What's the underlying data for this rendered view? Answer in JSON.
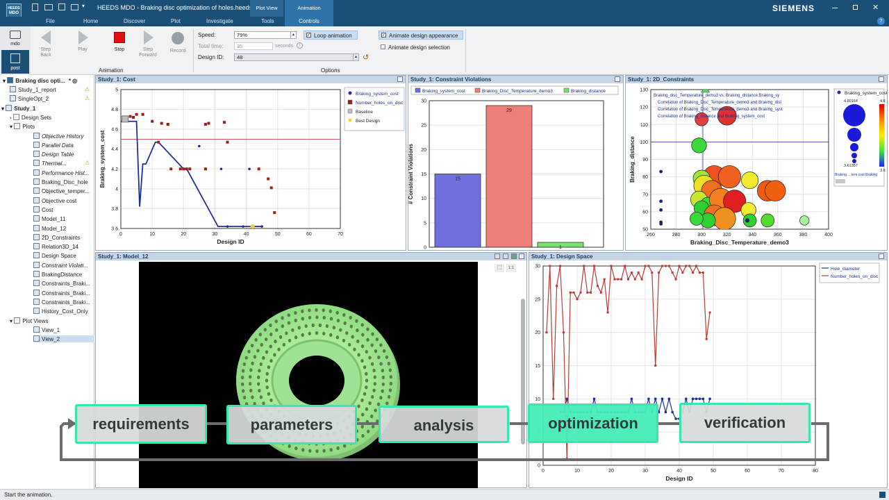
{
  "titlebar": {
    "app": "HEEDS MDO",
    "title": "HEEDS MDO - Braking disc optimization of holes.heeds *",
    "context_group1": "Plot View",
    "context_group2": "Animation",
    "brand": "SIEMENS",
    "app_icon_line1": "HEEDS",
    "app_icon_line2": "MDO"
  },
  "tabs": [
    "File",
    "Home",
    "Discover",
    "Plot",
    "Investigate",
    "Tools",
    "Controls"
  ],
  "ribbon": {
    "step_back": "Step\nBack",
    "step_back_1": "Step",
    "step_back_2": "Back",
    "play": "Play",
    "stop": "Stop",
    "step_fwd_1": "Step",
    "step_fwd_2": "Forward",
    "record": "Record",
    "group_animation": "Animation",
    "group_options": "Options",
    "speed_label": "Speed:",
    "speed_value": "79%",
    "total_time_label": "Total time:",
    "total_time_value": "35",
    "total_time_unit": "seconds",
    "design_id_label": "Design ID:",
    "design_id_value": "48",
    "loop": "Loop animation",
    "animate_appearance": "Animate design appearance",
    "animate_selection": "Animate design selection"
  },
  "leftnav": {
    "mdo": "mdo",
    "post": "post"
  },
  "tree": {
    "root": "Braking disc opti...",
    "items": [
      "Study_1_report",
      "SingleOpt_2",
      "Study_1",
      "Design Sets",
      "Plots",
      "Objective History",
      "Parallel Data",
      "Design Table",
      "Thermal...",
      "Performance Hist...",
      "Braking_Disc_hole",
      "Objective_temper...",
      "Objective cost",
      "Cost",
      "Model_11",
      "Model_12",
      "2D_Constraints",
      "Relation3D_14",
      "Design Space",
      "Constraint Violati...",
      "BrakingDistance",
      "Constraints_Braki...",
      "Constraints_Braki...",
      "Constraints_Braki...",
      "History_Cost_Only",
      "Plot Views",
      "View_1",
      "View_2"
    ]
  },
  "panels": {
    "cost": "Study_1: Cost",
    "cv": "Study_1: Constraint Violations",
    "c2d": "Study_1: 2D_Constraints",
    "model": "Study_1: Model_12",
    "ds": "Study_1: Design Space"
  },
  "chart_data": [
    {
      "type": "scatter",
      "title": "",
      "xlabel": "Design ID",
      "ylabel": "Braking_system_cost",
      "xlim": [
        0,
        70
      ],
      "ylim": [
        3.6,
        5
      ],
      "x_ticks": [
        "0",
        "10",
        "20",
        "30",
        "40",
        "50",
        "60",
        "70"
      ],
      "y_ticks": [
        "3.6",
        "3.8",
        "4",
        "4.2",
        "4.4",
        "4.6",
        "4.8",
        "5"
      ],
      "legend": [
        "Braking_system_cost",
        "Number_holes_on_disc",
        "Baseline",
        "Best Design"
      ],
      "series": [
        {
          "name": "Braking_system_cost",
          "x": [
            25,
            32,
            34,
            39,
            41,
            45
          ],
          "y": [
            4.43,
            4.2,
            3.62,
            3.62,
            4.2,
            3.62
          ]
        },
        {
          "name": "Number_holes_on_disc",
          "x": [
            2,
            3,
            4,
            5,
            7,
            10,
            12,
            13,
            15,
            15,
            16,
            19,
            20,
            21,
            22,
            27,
            27,
            28,
            33,
            34,
            44,
            47,
            48,
            49
          ],
          "y": [
            4.7,
            4.73,
            4.72,
            4.75,
            4.75,
            4.68,
            4.47,
            4.66,
            4.65,
            4.65,
            4.2,
            4.2,
            4.2,
            4.2,
            4.2,
            4.65,
            4.2,
            4.66,
            4.67,
            4.47,
            4.2,
            4.1,
            4.01,
            3.76
          ]
        }
      ],
      "step_line": {
        "x": [
          0,
          5,
          6,
          7,
          8,
          11,
          12,
          20,
          21,
          31,
          32,
          45
        ],
        "y": [
          4.68,
          4.68,
          3.82,
          4.25,
          4.25,
          4.47,
          4.47,
          4.2,
          4.2,
          3.62,
          3.62,
          3.62
        ]
      },
      "baseline_y": 4.5,
      "best_design": {
        "x": 42,
        "y": 3.62
      }
    },
    {
      "type": "bar",
      "title": "",
      "ylabel": "# Constraint Violations",
      "categories": [
        "Braking_system_cost",
        "Braking_Disc_Temperature_demo3",
        "Braking_distance"
      ],
      "values": [
        15,
        29,
        1
      ],
      "ylim": [
        0,
        30
      ],
      "y_ticks": [
        "0",
        "5",
        "10",
        "15",
        "20",
        "25",
        "30"
      ],
      "colors": [
        "#6f6fe0",
        "#ef7d78",
        "#77e36f"
      ]
    },
    {
      "type": "scatter",
      "title": "",
      "xlabel": "Braking_Disc_Temperature_demo3",
      "ylabel": "Braking_distance",
      "xlim": [
        260,
        400
      ],
      "ylim": [
        50,
        130
      ],
      "x_ticks": [
        "260",
        "280",
        "300",
        "320",
        "340",
        "360",
        "380",
        "400"
      ],
      "y_ticks": [
        "50",
        "60",
        "70",
        "80",
        "90",
        "100",
        "110",
        "120",
        "130"
      ],
      "legend_text": [
        "Braking_disc_Temperature_demo3 vs. Braking_distance,Braking_system_cost",
        "Correlation of Braking_Disc_Temperature_demo3 and Braking_distance = -0.",
        "Correlation of Braking_Disc_Temperature_demo3 and Braking_system_cost",
        "Correlation of Braking_distance and Braking_system_cost"
      ],
      "crosshair": {
        "x": 301,
        "y": 100
      },
      "size_legend": {
        "title": "Braking_system_cost",
        "max": "4.80164",
        "min": "3.61357",
        "colorbar_max": "4.8",
        "colorbar_min": "3.6",
        "footer": "Braking ... tem cost  Braking"
      },
      "bubbles": [
        {
          "x": 298,
          "y": 98,
          "s": 8,
          "c": "#3ad83a"
        },
        {
          "x": 300,
          "y": 113,
          "s": 7,
          "c": "#e14040"
        },
        {
          "x": 320,
          "y": 115,
          "s": 10,
          "c": "#e03030"
        },
        {
          "x": 310,
          "y": 80,
          "s": 12,
          "c": "#f05020"
        },
        {
          "x": 322,
          "y": 80,
          "s": 12,
          "c": "#f06020"
        },
        {
          "x": 300,
          "y": 79,
          "s": 9,
          "c": "#9ae83a"
        },
        {
          "x": 302,
          "y": 75,
          "s": 11,
          "c": "#ece020"
        },
        {
          "x": 308,
          "y": 72,
          "s": 11,
          "c": "#f07020"
        },
        {
          "x": 338,
          "y": 78,
          "s": 9,
          "c": "#f2ec30"
        },
        {
          "x": 352,
          "y": 72,
          "s": 11,
          "c": "#f05a10"
        },
        {
          "x": 358,
          "y": 72,
          "s": 11,
          "c": "#f06010"
        },
        {
          "x": 298,
          "y": 67,
          "s": 9,
          "c": "#c8e830"
        },
        {
          "x": 305,
          "y": 64,
          "s": 8,
          "c": "#3ad83a"
        },
        {
          "x": 315,
          "y": 67,
          "s": 12,
          "c": "#f08020"
        },
        {
          "x": 326,
          "y": 66,
          "s": 12,
          "c": "#e02020"
        },
        {
          "x": 337,
          "y": 61,
          "s": 8,
          "c": "#f2ec30"
        },
        {
          "x": 300,
          "y": 62,
          "s": 8,
          "c": "#30d030"
        },
        {
          "x": 310,
          "y": 58,
          "s": 11,
          "c": "#f07020"
        },
        {
          "x": 318,
          "y": 56,
          "s": 12,
          "c": "#f09020"
        },
        {
          "x": 305,
          "y": 55,
          "s": 8,
          "c": "#30d030"
        },
        {
          "x": 338,
          "y": 55,
          "s": 7,
          "c": "#30d030"
        },
        {
          "x": 352,
          "y": 55,
          "s": 7,
          "c": "#50dd30"
        },
        {
          "x": 381,
          "y": 55,
          "s": 5,
          "c": "#a8f0a0"
        },
        {
          "x": 296,
          "y": 56,
          "s": 7,
          "c": "#3ad83a"
        },
        {
          "x": 268,
          "y": 83,
          "s": 1.5,
          "c": "#1a1a9a"
        },
        {
          "x": 268,
          "y": 66,
          "s": 1.5,
          "c": "#1a1a9a"
        },
        {
          "x": 268,
          "y": 61,
          "s": 1.5,
          "c": "#1a1a9a"
        },
        {
          "x": 268,
          "y": 54,
          "s": 1.5,
          "c": "#1a1a9a"
        },
        {
          "x": 268,
          "y": 53,
          "s": 1.5,
          "c": "#1a1a9a"
        },
        {
          "x": 336,
          "y": 55,
          "s": 2,
          "c": "#1a1a9a"
        }
      ]
    },
    {
      "type": "line",
      "title": "",
      "xlabel": "Design ID",
      "ylabel": "",
      "xlim": [
        0,
        80
      ],
      "ylim": [
        0,
        30
      ],
      "x_ticks": [
        "0",
        "10",
        "20",
        "30",
        "40",
        "50",
        "60",
        "70",
        "80"
      ],
      "y_ticks": [
        "0",
        "5",
        "10",
        "15",
        "20",
        "25",
        "30"
      ],
      "series": [
        {
          "name": "Hole_diameter",
          "color": "#1c2f9a",
          "x": [
            5,
            6,
            7,
            8,
            9,
            10,
            11,
            12,
            13,
            14,
            15,
            16,
            17,
            18,
            19,
            20,
            21,
            22,
            23,
            24,
            25,
            26,
            27,
            28,
            29,
            30,
            31,
            32,
            33,
            34,
            35,
            36,
            37,
            38,
            39,
            40,
            41,
            42,
            43,
            44,
            45,
            46,
            47,
            48,
            49
          ],
          "y": [
            8,
            8,
            10,
            8,
            8,
            8,
            8,
            8,
            8,
            8,
            10,
            8,
            8,
            8,
            8,
            8,
            8,
            8,
            8,
            8,
            8,
            10,
            8,
            8,
            8,
            8,
            10,
            8,
            10,
            8,
            10,
            8,
            10,
            8,
            7,
            7,
            8,
            10,
            8,
            10,
            10,
            10,
            10,
            8,
            10
          ]
        },
        {
          "name": "Number_holes_on_disc",
          "color": "#b83a36",
          "x": [
            1,
            2,
            3,
            4,
            5,
            6,
            7,
            8,
            9,
            10,
            11,
            12,
            13,
            14,
            15,
            16,
            17,
            18,
            19,
            20,
            21,
            22,
            23,
            24,
            25,
            26,
            27,
            28,
            29,
            30,
            31,
            32,
            33,
            34,
            35,
            36,
            37,
            38,
            39,
            40,
            41,
            42,
            43,
            44,
            45,
            46,
            47,
            48,
            49
          ],
          "y": [
            20,
            30,
            10,
            27,
            30,
            20,
            1,
            26,
            26,
            25,
            26,
            30,
            26,
            26,
            30,
            27,
            26,
            28,
            23,
            30,
            28,
            28,
            28,
            30,
            28,
            29,
            28,
            29,
            28,
            30,
            30,
            29,
            15,
            29,
            30,
            30,
            30,
            29,
            28,
            30,
            29,
            30,
            30,
            29,
            30,
            29,
            29,
            19,
            23
          ]
        }
      ]
    }
  ],
  "model_view": {
    "btn1": "⬚",
    "btn2": "1:1"
  },
  "process": [
    "requirements",
    "parameters",
    "analysis",
    "optimization",
    "verification"
  ],
  "status": "Start the animation."
}
